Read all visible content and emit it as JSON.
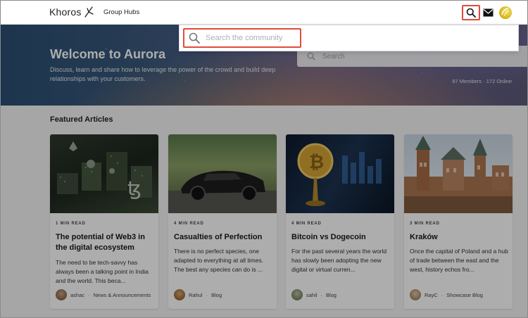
{
  "header": {
    "logo_text": "Khoros",
    "nav_link": "Group Hubs",
    "search_icon": "search-icon",
    "mail_icon": "mail-icon"
  },
  "banner": {
    "title": "Welcome to Aurora",
    "description": "Discuss, learn and share how to leverage the power of the crowd and build deep relationships with your customers.",
    "search_placeholder": "Search",
    "stats": "87 Members · 172 Online"
  },
  "search_panel": {
    "placeholder": "Search the community"
  },
  "featured": {
    "title": "Featured Articles",
    "cards": [
      {
        "read_time": "1 MIN READ",
        "title": "The potential of Web3 in the digital ecosystem",
        "excerpt": "The need to be tech-savvy has always been a talking point in India and the world. This beca...",
        "author": "ashac",
        "board": "News & Announcements"
      },
      {
        "read_time": "4 MIN READ",
        "title": "Casualties of Perfection",
        "excerpt": "There is no perfect species, one adapted to everything at all times. The best any species can do is ...",
        "author": "Rahul",
        "board": "Blog"
      },
      {
        "read_time": "4 MIN READ",
        "title": "Bitcoin vs Dogecoin",
        "excerpt": "For the past several years the world has slowly been adopting the new digital or virtual curren...",
        "author": "sahil",
        "board": "Blog"
      },
      {
        "read_time": "3 MIN READ",
        "title": "Kraków",
        "excerpt": "Once the capital of Poland and a hub of trade between the east and the west, history echos fro...",
        "author": "RayC",
        "board": "Showcase Blog"
      }
    ]
  },
  "colors": {
    "highlight": "#e24a3b",
    "text_dark": "#1a1a1a"
  }
}
